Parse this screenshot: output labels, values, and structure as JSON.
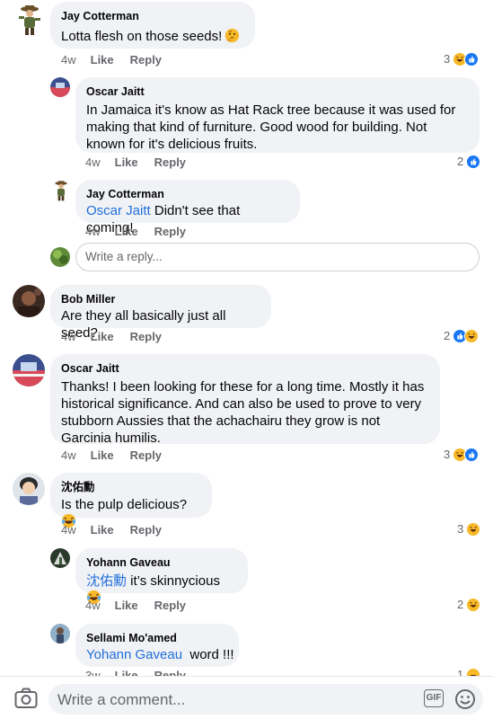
{
  "comments": [
    {
      "name": "Jay Cotterman",
      "text": "Lotta flesh on those seeds!",
      "emoji": "thinking-face",
      "time": "4w",
      "like": "Like",
      "reply": "Reply",
      "reactions": "3",
      "reaction_icons": [
        "haha",
        "like"
      ]
    },
    {
      "name": "Oscar Jaitt",
      "text": "In Jamaica it's know as Hat Rack tree because it was used for making that kind of furniture. Good wood for building. Not known for it's delicious fruits.",
      "time": "4w",
      "like": "Like",
      "reply": "Reply",
      "reactions": "2",
      "reaction_icons": [
        "like"
      ]
    },
    {
      "name": "Jay Cotterman",
      "mention": "Oscar Jaitt",
      "text": " Didn't see that coming!",
      "time": "4w",
      "like": "Like",
      "reply": "Reply"
    },
    {
      "name": "Bob Miller",
      "text": "Are they all basically just all seed?",
      "time": "4w",
      "like": "Like",
      "reply": "Reply",
      "reactions": "2",
      "reaction_icons": [
        "like",
        "haha"
      ]
    },
    {
      "name": "Oscar Jaitt",
      "text": "Thanks! I been looking for these for a long time. Mostly it has historical significance. And can also be used to prove to very stubborn Aussies that the achachairu they grow is not Garcinia humilis.",
      "time": "4w",
      "like": "Like",
      "reply": "Reply",
      "reactions": "3",
      "reaction_icons": [
        "haha",
        "like"
      ]
    },
    {
      "name": "沈佑勳",
      "text": "Is the pulp delicious?",
      "emoji": "laughing-face",
      "time": "4w",
      "like": "Like",
      "reply": "Reply",
      "reactions": "3",
      "reaction_icons": [
        "haha"
      ]
    },
    {
      "name": "Yohann Gaveau",
      "mention": "沈佑勳",
      "text": " it’s skinnycious ",
      "emoji": "laughing-face",
      "time": "4w",
      "like": "Like",
      "reply": "Reply",
      "reactions": "2",
      "reaction_icons": [
        "haha"
      ]
    },
    {
      "name": "Sellami Mo'amed",
      "mention": "Yohann Gaveau",
      "text": "  word !!!",
      "time": "3w",
      "like": "Like",
      "reply": "Reply",
      "reactions": "1",
      "reaction_icons": [
        "haha"
      ]
    }
  ],
  "reply_placeholder": "Write a reply...",
  "composer": {
    "placeholder": "Write a comment...",
    "gif_label": "GIF",
    "camera_icon": "camera-icon",
    "emoji_icon": "smiley-icon"
  },
  "colors": {
    "bubble": "#f0f2f5",
    "mention": "#216fdb",
    "meta": "#65676b",
    "like_blue": "#1877f2",
    "haha_yellow": "#f7b928"
  }
}
